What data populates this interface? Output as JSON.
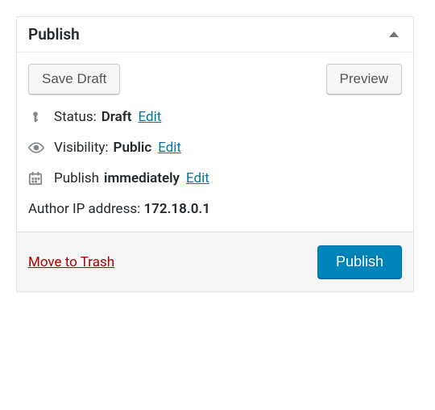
{
  "panel": {
    "title": "Publish"
  },
  "actions": {
    "save_draft": "Save Draft",
    "preview": "Preview",
    "publish": "Publish",
    "trash": "Move to Trash"
  },
  "status": {
    "label": "Status:",
    "value": "Draft",
    "edit": "Edit"
  },
  "visibility": {
    "label": "Visibility:",
    "value": "Public",
    "edit": "Edit"
  },
  "schedule": {
    "label": "Publish",
    "value": "immediately",
    "edit": "Edit"
  },
  "author_ip": {
    "label": "Author IP address:",
    "value": "172.18.0.1"
  }
}
